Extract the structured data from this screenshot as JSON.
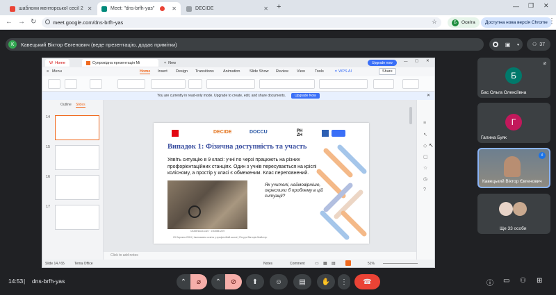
{
  "browser": {
    "tabs": [
      {
        "label": "шаблони менторської сесії 2",
        "color": "#ea4335"
      },
      {
        "label": "Meet: \"dns-brfh-yas\"",
        "color": "#00897b"
      },
      {
        "label": "DECIDE",
        "color": "#5f6368"
      }
    ],
    "new_tab_symbol": "+",
    "url": "meet.google.com/dns-brfh-yas",
    "profile_label": "Освіта",
    "profile_initial": "Б",
    "update_label": "Доступна нова версія Chrome"
  },
  "meet": {
    "presenter_initial": "К",
    "presenter_banner": "Кавецький Віктор Євгенович (веде презентацію, додає примітки)",
    "participants_count": "37",
    "time": "14:53",
    "meeting_code": "dns-brfh-yas",
    "tiles": [
      {
        "initial": "Б",
        "name": "Бас Ольга Олексіївна",
        "color": "#00796b"
      },
      {
        "initial": "Г",
        "name": "Галина Буяк",
        "color": "#c2185b"
      },
      {
        "initial": "",
        "name": "Кавецький Віктор Євгенович",
        "color": ""
      },
      {
        "initial": "",
        "name": "Ще 33 особи",
        "color": ""
      }
    ]
  },
  "wps": {
    "home_tab": "Home",
    "doc_tab": "Супровідна презентація Mi",
    "new_tab": "New",
    "upgrade_now_top": "Upgrade now",
    "menu_label": "Menu",
    "ribbon_tabs": [
      "Home",
      "Insert",
      "Design",
      "Transitions",
      "Animation",
      "Slide Show",
      "Review",
      "View",
      "Tools"
    ],
    "wps_ai": "WPS AI",
    "share_label": "Share",
    "tool_labels": [
      "Format Painter",
      "Paste",
      "From Current Slide",
      "Slide Tools",
      "Settings"
    ],
    "readonly_notice": "You are currently in read-only mode. Upgrade to create, edit, and share documents.",
    "upgrade_now": "Upgrade Now",
    "outline_tab": "Outline",
    "slides_tab": "Slides",
    "thumb_numbers": [
      "14",
      "15",
      "16",
      "17"
    ],
    "notes_placeholder": "Click to add notes",
    "status_slide": "Slide 14 / 65",
    "status_theme": "Tema Office",
    "status_notes": "Notes",
    "status_comment": "Comment",
    "zoom": "51%"
  },
  "slide": {
    "logos": [
      "DECIDE",
      "DOCCU",
      "PH ZH"
    ],
    "title": "Випадок 1: Фізична доступність та участь",
    "body": "Уявіть ситуацію в 9 класі: учні по черзі працюють на різних профорієнтаційних станціях. Один з учнів пересувається на кріслі колісному, а простір у класі є обмеженим. Клас переповнений.",
    "question": "Як учителі, наймовірніше, окреслили б проблему в цій ситуації?",
    "photo_credit": "shutterstock.com · 2300881229",
    "footer": "29 березня 2024 | Інклюзивна освіта у професійній школі | Ресурс Вікторія Майстер"
  },
  "colors": {
    "meet_bg": "#202124",
    "end_call": "#ea4335",
    "wps_orange": "#f06a1f",
    "slide_title": "#3a4fa0"
  }
}
